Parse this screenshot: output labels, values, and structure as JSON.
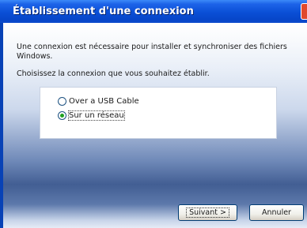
{
  "window": {
    "title": "Établissement d'une connexion"
  },
  "content": {
    "message": "Une connexion est nécessaire pour installer et synchroniser des fichiers Windows.",
    "choose_label": "Choisissez la connexion que vous souhaitez établir."
  },
  "options": [
    {
      "label": "Over a USB Cable",
      "selected": false
    },
    {
      "label": "Sur un réseau",
      "selected": true
    }
  ],
  "buttons": {
    "next": "Suivant >",
    "cancel": "Annuler"
  },
  "colors": {
    "titlebar": "#0a4fd6",
    "frame": "#0842b6",
    "close": "#e0492d"
  }
}
